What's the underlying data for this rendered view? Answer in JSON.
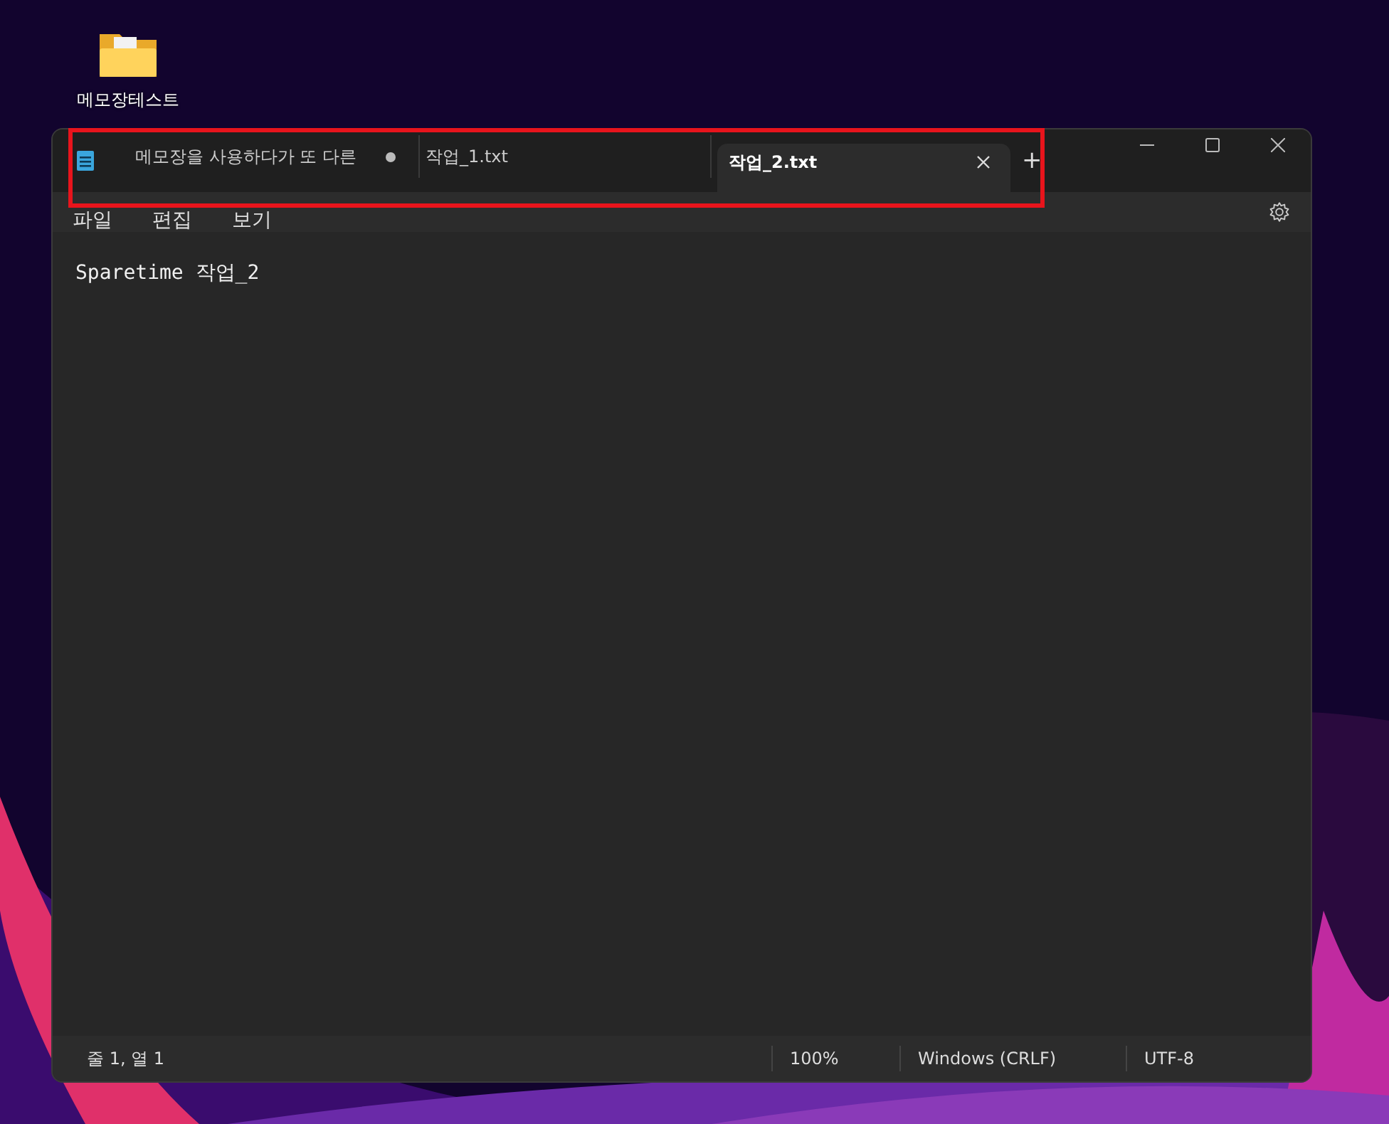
{
  "desktop_icon": {
    "label": "메모장테스트"
  },
  "tabs": [
    {
      "label": "메모장을 사용하다가 또 다른",
      "selected": false,
      "modified": true
    },
    {
      "label": "작업_1.txt",
      "selected": false,
      "modified": false
    },
    {
      "label": "작업_2.txt",
      "selected": true,
      "modified": false
    }
  ],
  "new_tab": "+",
  "menu": [
    "파일",
    "편집",
    "보기"
  ],
  "editor": {
    "text": "Sparetime 작업_2"
  },
  "status_bar": {
    "position": "줄 1, 열 1",
    "zoom": "100%",
    "line_ending": "Windows (CRLF)",
    "encoding": "UTF-8"
  },
  "highlight": {
    "on": true
  }
}
